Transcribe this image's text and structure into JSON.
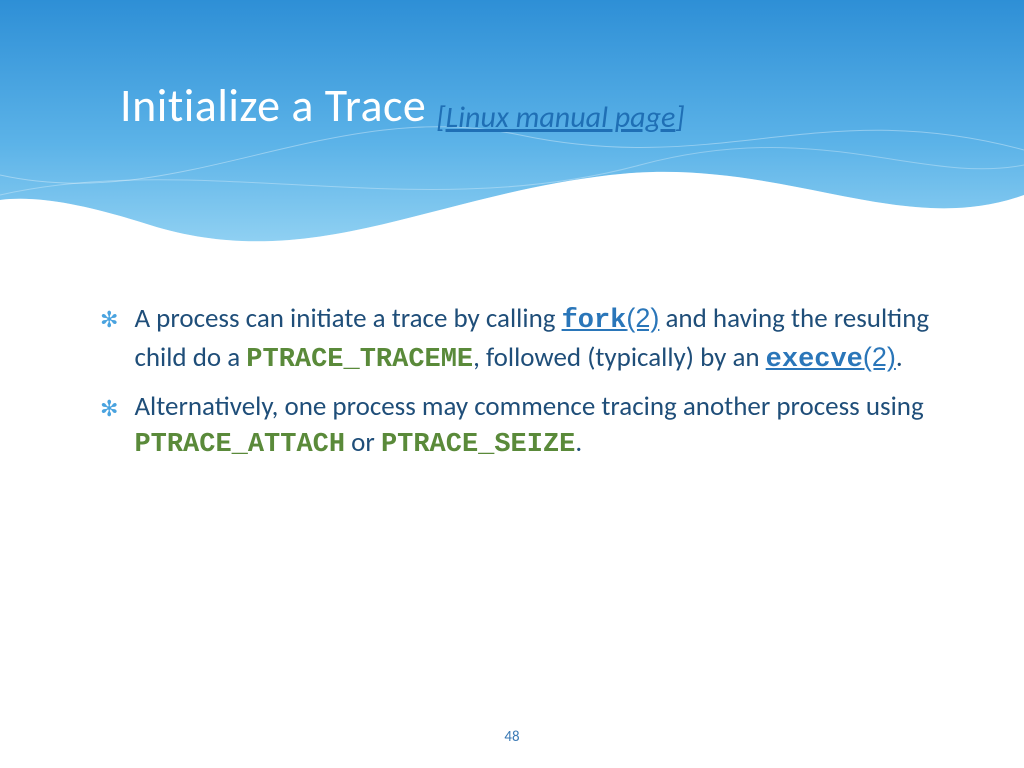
{
  "header": {
    "title": "Initialize a Trace",
    "bracket_open": "[",
    "link_text": "Linux manual page",
    "bracket_close": "]"
  },
  "bullet1": {
    "t1": "A process can initiate a trace by calling ",
    "fork": "fork",
    "fork_num": "(2)",
    "t2": " and having the resulting child do a ",
    "traceme": "PTRACE_TRACEME",
    "t3": ", followed (typically) by an ",
    "execve": "execve",
    "execve_num": "(2)",
    "t4": "."
  },
  "bullet2": {
    "t1": "Alternatively, one process may commence tracing another process using ",
    "attach": "PTRACE_ATTACH",
    "t2": " or ",
    "seize": "PTRACE_SEIZE",
    "t3": "."
  },
  "page_number": "48"
}
